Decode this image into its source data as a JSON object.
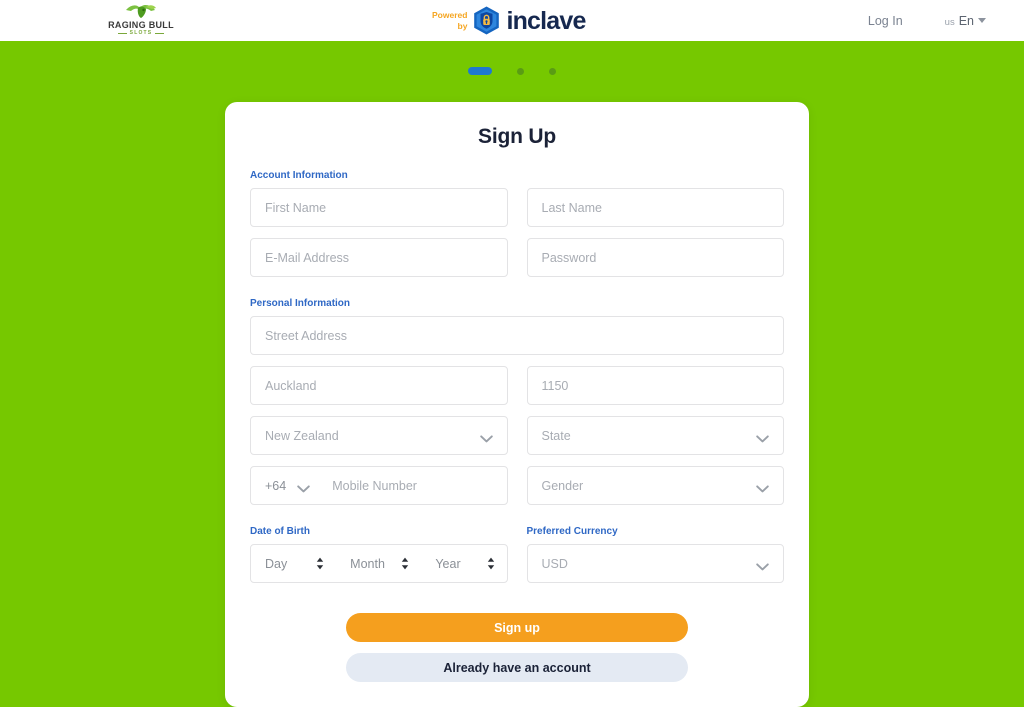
{
  "header": {
    "brand": {
      "name": "RAGING BULL",
      "sub": "SLOTS",
      "icon": "bull-icon"
    },
    "inclave": {
      "powered": "Powered",
      "by": "by",
      "wordmark": "inclave",
      "icon": "shield-lock-icon"
    },
    "login_label": "Log In",
    "language": {
      "country": "us",
      "code": "En",
      "caret": "caret-down-icon"
    }
  },
  "progress": {
    "steps": [
      {
        "state": "active"
      },
      {
        "state": "inactive"
      },
      {
        "state": "inactive"
      }
    ]
  },
  "card": {
    "title": "Sign Up",
    "sections": {
      "account": "Account Information",
      "personal": "Personal Information",
      "dob": "Date of Birth",
      "currency": "Preferred Currency"
    },
    "fields": {
      "first_name": {
        "placeholder": "First Name",
        "value": ""
      },
      "last_name": {
        "placeholder": "Last Name",
        "value": ""
      },
      "email": {
        "placeholder": "E-Mail Address",
        "value": ""
      },
      "password": {
        "placeholder": "Password",
        "value": ""
      },
      "street": {
        "placeholder": "Street Address",
        "value": ""
      },
      "city": {
        "placeholder": "Auckland",
        "value": ""
      },
      "postcode": {
        "placeholder": "1150",
        "value": ""
      },
      "country": {
        "selected": "New Zealand"
      },
      "state": {
        "selected": "State"
      },
      "phone_cc": {
        "selected": "+64"
      },
      "mobile": {
        "placeholder": "Mobile Number",
        "value": ""
      },
      "gender": {
        "selected": "Gender"
      },
      "dob_day": {
        "selected": "Day"
      },
      "dob_month": {
        "selected": "Month"
      },
      "dob_year": {
        "selected": "Year"
      },
      "currency": {
        "selected": "USD"
      }
    },
    "buttons": {
      "signup": "Sign up",
      "existing": "Already have an account"
    }
  },
  "colors": {
    "background_green": "#76c800",
    "accent_blue": "#2f68c5",
    "primary_orange": "#f59f1e",
    "secondary_bg": "#e4eaf3",
    "text_dark": "#1b2237",
    "placeholder": "#a8acb3",
    "step_active": "#1f78d1"
  }
}
